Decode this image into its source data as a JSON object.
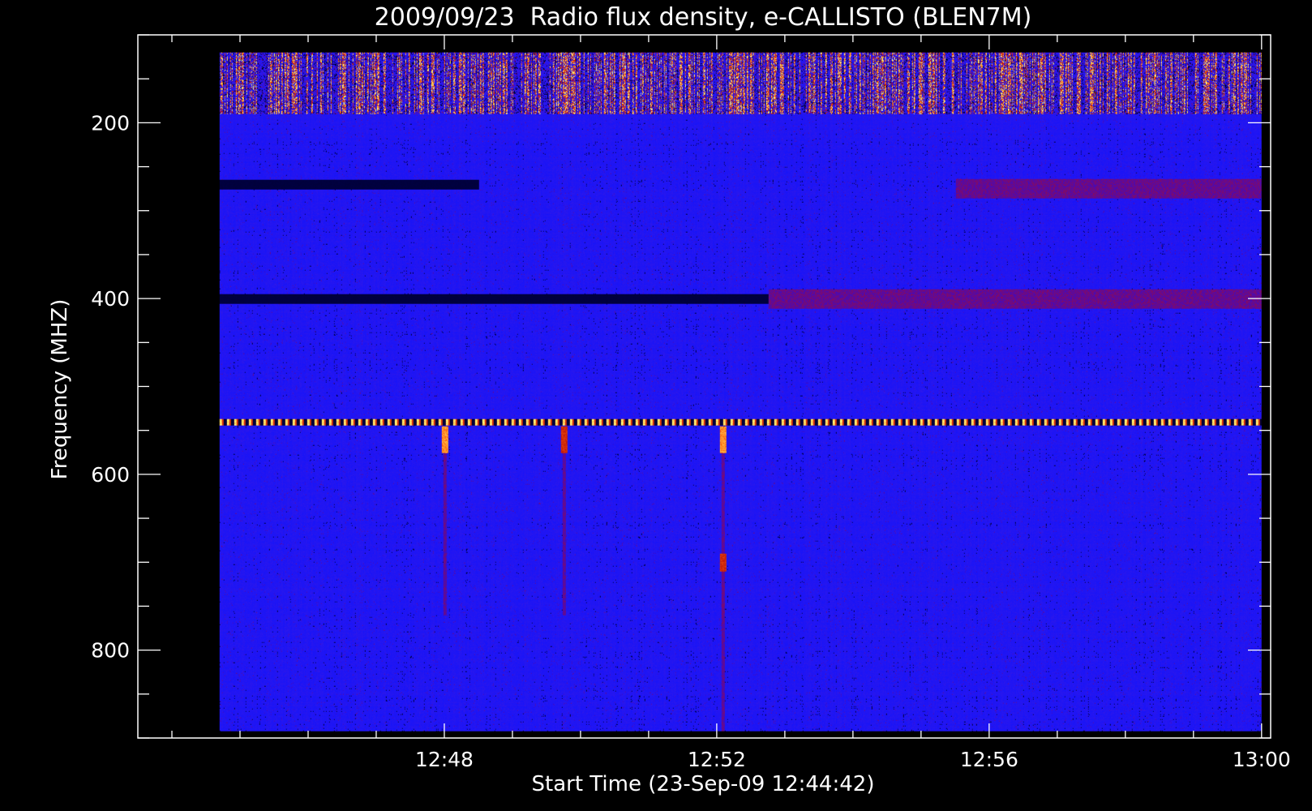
{
  "chart_data": {
    "type": "heatmap",
    "title": "2009/09/23  Radio flux density, e-CALLISTO (BLEN7M)",
    "xlabel": "Start Time (23-Sep-09 12:44:42)",
    "ylabel": "Frequency (MHZ)",
    "xlim": [
      "12:43:30",
      "13:00:08"
    ],
    "ylim": [
      900,
      100
    ],
    "data_extent": {
      "x": [
        "12:44:42",
        "13:00:00"
      ],
      "y": [
        120,
        892
      ]
    },
    "x_ticks": [
      "12:48",
      "12:52",
      "12:56",
      "13:00"
    ],
    "y_ticks": [
      200,
      400,
      600,
      800
    ],
    "colormap": [
      "#000000",
      "#1a1aff",
      "#cc0000",
      "#ff6600",
      "#ffff66"
    ],
    "background_color": "#000000",
    "foreground_color": "#ffffff",
    "features": [
      {
        "kind": "interference band",
        "freq_range": [
          120,
          190
        ],
        "time_range": [
          "12:44:42",
          "13:00:00"
        ],
        "intensity": "high"
      },
      {
        "kind": "dark band",
        "freq": 270,
        "time_range": [
          "12:44:42",
          "12:48:30"
        ],
        "intensity": "low"
      },
      {
        "kind": "enhanced band",
        "freq": 275,
        "time_range": [
          "12:55:30",
          "13:00:00"
        ],
        "intensity": "moderate"
      },
      {
        "kind": "dark band",
        "freq": 400,
        "time_range": [
          "12:44:42",
          "12:52:45"
        ],
        "intensity": "low"
      },
      {
        "kind": "enhanced band",
        "freq": 400,
        "time_range": [
          "12:52:45",
          "13:00:00"
        ],
        "intensity": "moderate"
      },
      {
        "kind": "periodic line",
        "freq": 540,
        "time_range": [
          "12:44:42",
          "13:00:00"
        ],
        "intensity": "high"
      },
      {
        "kind": "burst",
        "time": "12:48:00",
        "freq_range": [
          545,
          575
        ],
        "intensity": "high"
      },
      {
        "kind": "burst",
        "time": "12:49:45",
        "freq_range": [
          545,
          575
        ],
        "intensity": "moderate"
      },
      {
        "kind": "burst",
        "time": "12:52:05",
        "freq_range": [
          545,
          575
        ],
        "intensity": "high"
      },
      {
        "kind": "burst",
        "time": "12:52:05",
        "freq_range": [
          690,
          710
        ],
        "intensity": "moderate"
      }
    ]
  }
}
